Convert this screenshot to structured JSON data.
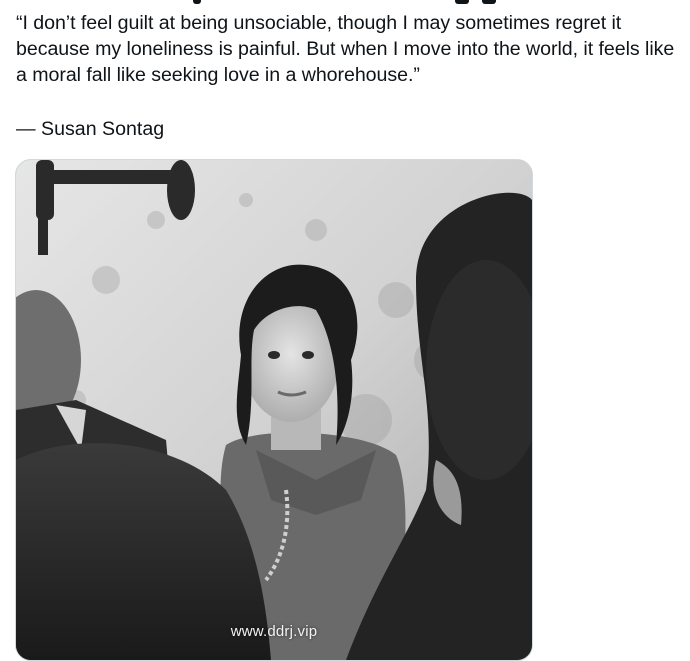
{
  "post": {
    "quote_text": "“I don’t feel guilt at being unsociable, though I may sometimes regret it because my loneliness is painful. But when I move into the world, it feels like a moral fall like seeking love in a whorehouse.”",
    "author_line": "— Susan Sontag"
  },
  "media": {
    "description_hidden": "",
    "watermark": "www.ddrj.vip"
  },
  "colors": {
    "text": "#0f1419",
    "border": "#cfd9de"
  }
}
